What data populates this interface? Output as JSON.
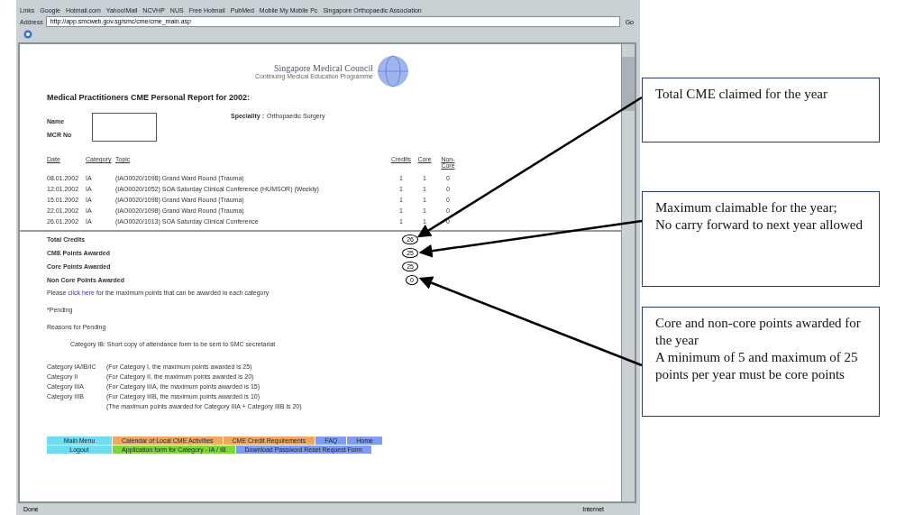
{
  "links_bar": {
    "label": "Links",
    "items": [
      "Google",
      "Hotmail.com",
      "Yahoo!Mail",
      "NCVHP",
      "NUS",
      "Free Hotmail",
      "PubMed",
      "Mobile My Mobile Pc",
      "Singapore Orthopaedic Association"
    ]
  },
  "address_bar": {
    "label": "Address",
    "url": "http://app.smcweb.gov.sg/smc/cme/cme_main.asp",
    "go": "Go"
  },
  "header": {
    "org": "Singapore Medical Council",
    "program": "Continuing Medical Education Programme"
  },
  "title": "Medical Practitioners CME Personal Report for 2002:",
  "fields": [
    {
      "label": "Name"
    },
    {
      "label": "MCR No"
    }
  ],
  "speciality": {
    "label": "Speciality :",
    "value": "Orthopaedic Surgery"
  },
  "table": {
    "columns": [
      "Date",
      "Category",
      "Topic",
      "Credits",
      "Core",
      "Non-Core"
    ],
    "rows": [
      [
        "08.01.2002",
        "IA",
        "(IAO0020/1098) Grand Ward Round (Trauma)",
        "1",
        "1",
        "0"
      ],
      [
        "12.01.2002",
        "IA",
        "(IAO0020/1052) SOA Saturday Clinical Conference (HUMSOR) (Weekly)",
        "1",
        "1",
        "0"
      ],
      [
        "15.01.2002",
        "IA",
        "(IAO0020/1098) Grand Ward Round (Trauma)",
        "1",
        "1",
        "0"
      ],
      [
        "22.01.2002",
        "IA",
        "(IAO0020/1098) Grand Ward Round (Trauma)",
        "1",
        "1",
        "0"
      ],
      [
        "26.01.2002",
        "IA",
        "(IAO0020/1013) SOA Saturday Clinical Conference",
        "1",
        "1",
        "0"
      ]
    ]
  },
  "summary": [
    {
      "label": "Total Credits",
      "value": "26"
    },
    {
      "label": "CME Points Awarded",
      "value": "25"
    },
    {
      "label": "Core Points Awarded",
      "value": "25"
    },
    {
      "label": "Non Core Points Awarded",
      "value": "0"
    }
  ],
  "note": {
    "before": "Please",
    "link": "click here",
    "after": "for the maximum points that can be awarded in each category"
  },
  "pending": "*Pending",
  "reasons_title": "Reasons for Pending",
  "reason": "Category IB: Short copy of attendance form to be sent to SMC secretariat",
  "category_notes": [
    {
      "category": "Category IA/IB/IC",
      "text": "(For Category I, the maximum points awarded is 25)"
    },
    {
      "category": "Category II",
      "text": "(For Category II, the maximum points awarded is 20)"
    },
    {
      "category": "Category IIIA",
      "text": "(For Category IIIA, the maximum points awarded is 15)"
    },
    {
      "category": "Category IIIB",
      "text": "(For Category IIIB, the maximum points awarded is 10)"
    }
  ],
  "category_footnote": "(The maximum points awarded for Category IIIA + Category IIIB is 20)",
  "nav": [
    [
      {
        "label": "Main Menu",
        "color": "#6fdcf0"
      },
      {
        "label": "Calendar of Local CME Activities",
        "color": "#f0a860"
      },
      {
        "label": "CME Credit Requirements",
        "color": "#f0a860"
      },
      {
        "label": "FAQ",
        "color": "#7f9cf0"
      },
      {
        "label": "Home",
        "color": "#7f9cf0"
      }
    ],
    [
      {
        "label": "Logout",
        "color": "#6fdcf0"
      },
      {
        "label": "Application form for Category - IA / IB",
        "color": "#7ed83a"
      },
      {
        "label": "Download Password Reset Request Form",
        "color": "#7f9cf0"
      }
    ]
  ],
  "status_bar": {
    "left": "Done",
    "right": "Internet"
  },
  "callouts": [
    {
      "text": "Total CME claimed for the year"
    },
    {
      "text": "Maximum claimable for the year;\nNo carry forward to next year allowed"
    },
    {
      "text": "Core and non-core points awarded for the year\nA minimum of 5 and maximum of 25 points per year must be core points"
    }
  ]
}
